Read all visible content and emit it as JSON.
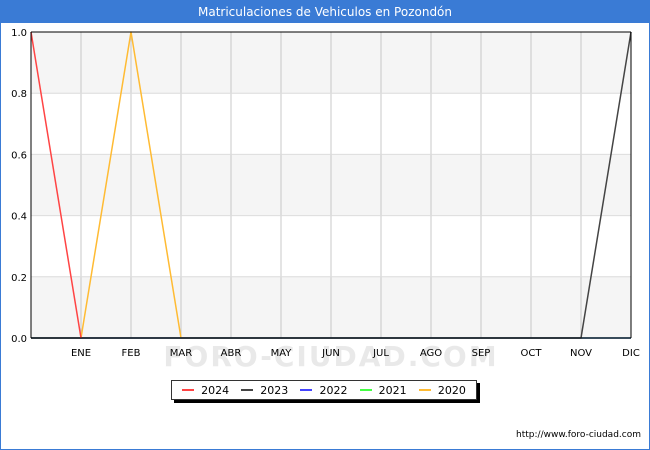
{
  "title": "Matriculaciones de Vehiculos en Pozondón",
  "watermark": "FORO-CIUDAD.COM",
  "footer_url": "http://www.foro-ciudad.com",
  "chart_data": {
    "type": "line",
    "x": [
      "",
      "ENE",
      "FEB",
      "MAR",
      "ABR",
      "MAY",
      "JUN",
      "JUL",
      "AGO",
      "SEP",
      "OCT",
      "NOV",
      "DIC"
    ],
    "ylim": [
      0,
      1
    ],
    "yticks": [
      "0.0",
      "0.2",
      "0.4",
      "0.6",
      "0.8",
      "1.0"
    ],
    "grid": true,
    "legend_position": "bottom-center",
    "series": [
      {
        "name": "2024",
        "color": "#ff4444",
        "values": [
          1,
          0,
          null,
          null,
          null,
          null,
          null,
          null,
          null,
          null,
          null,
          null,
          null
        ]
      },
      {
        "name": "2023",
        "color": "#444444",
        "values": [
          0,
          0,
          0,
          0,
          0,
          0,
          0,
          0,
          0,
          0,
          0,
          0,
          1
        ]
      },
      {
        "name": "2022",
        "color": "#4444ff",
        "values": [
          0,
          0,
          0,
          0,
          0,
          0,
          0,
          0,
          0,
          0,
          0,
          0,
          0
        ]
      },
      {
        "name": "2021",
        "color": "#44ff44",
        "values": [
          0,
          0,
          0,
          0,
          0,
          0,
          0,
          0,
          0,
          0,
          0,
          0,
          0
        ]
      },
      {
        "name": "2020",
        "color": "#ffbb33",
        "values": [
          0,
          0,
          1,
          0,
          0,
          0,
          0,
          0,
          0,
          0,
          0,
          0,
          0
        ]
      }
    ]
  }
}
